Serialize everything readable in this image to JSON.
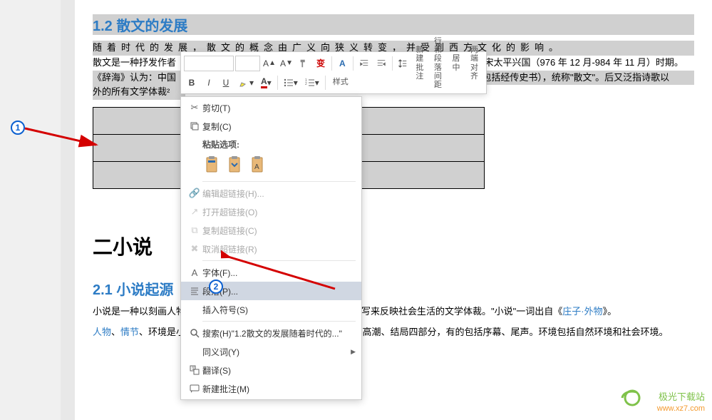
{
  "document": {
    "heading12": "1.2 散文的发展",
    "para1_highlighted": "随着时代的发展，散文的概念由广义向狭义转变，并受到西方文化的影响。",
    "para2_prefix": "散文是一种抒发作者",
    "para2_suffix": "裁。\"散文\"一词大约出现在北宋太平兴国（976 年 12 月-984 年 11 月）时期。",
    "para3_prefix": "《辞海》认为：中国",
    "para3_suffix": "韵、不重排偶' 的散体文章（包括经传史书），统称\"散文\"。后又泛指诗歌以",
    "para4": "外的所有文学体裁²",
    "heading2": "二小说",
    "heading21": "2.1 小说起源",
    "para5_a": "小说是一种以刻画人物形象为中心、通过完整的故事情节和环境描写来反映社会生活的文学体裁。\"小说\"一词出自《",
    "para5_link": "庄子·外物",
    "para5_b": "》。",
    "para6_link1": "人物",
    "para6_s1": "、",
    "para6_link2": "情节",
    "para6_s2": "、环境是小说的三要素[1]。情节一般包括开端、发展、高潮、结局四部分，有的包括序幕、尾声。环境包括自然环境和社会环境。"
  },
  "mini_toolbar": {
    "fontname_placeholder": "",
    "fontsize_placeholder": "",
    "bold": "B",
    "italic": "I",
    "underline": "U",
    "styles": "样式",
    "new_comment": "新建\n批注",
    "line_para_spacing": "行和段落\n间距",
    "center": "居中",
    "justify": "两端对齐"
  },
  "context_menu": {
    "cut": "剪切(T)",
    "copy": "复制(C)",
    "paste_options_label": "粘贴选项:",
    "edit_hyperlink": "编辑超链接(H)...",
    "open_hyperlink": "打开超链接(O)",
    "copy_hyperlink": "复制超链接(C)",
    "remove_hyperlink": "取消超链接(R)",
    "font": "字体(F)...",
    "paragraph": "段落(P)...",
    "insert_symbol": "插入符号(S)",
    "search": "搜索(H)\"1.2散文的发展随着时代的...\"",
    "synonyms": "同义词(Y)",
    "translate": "翻译(S)",
    "new_comment": "新建批注(M)"
  },
  "watermark": {
    "line1": "极光下载站",
    "line2": "www.xz7.com"
  },
  "annotations": {
    "badge1": "1",
    "badge2": "2"
  }
}
